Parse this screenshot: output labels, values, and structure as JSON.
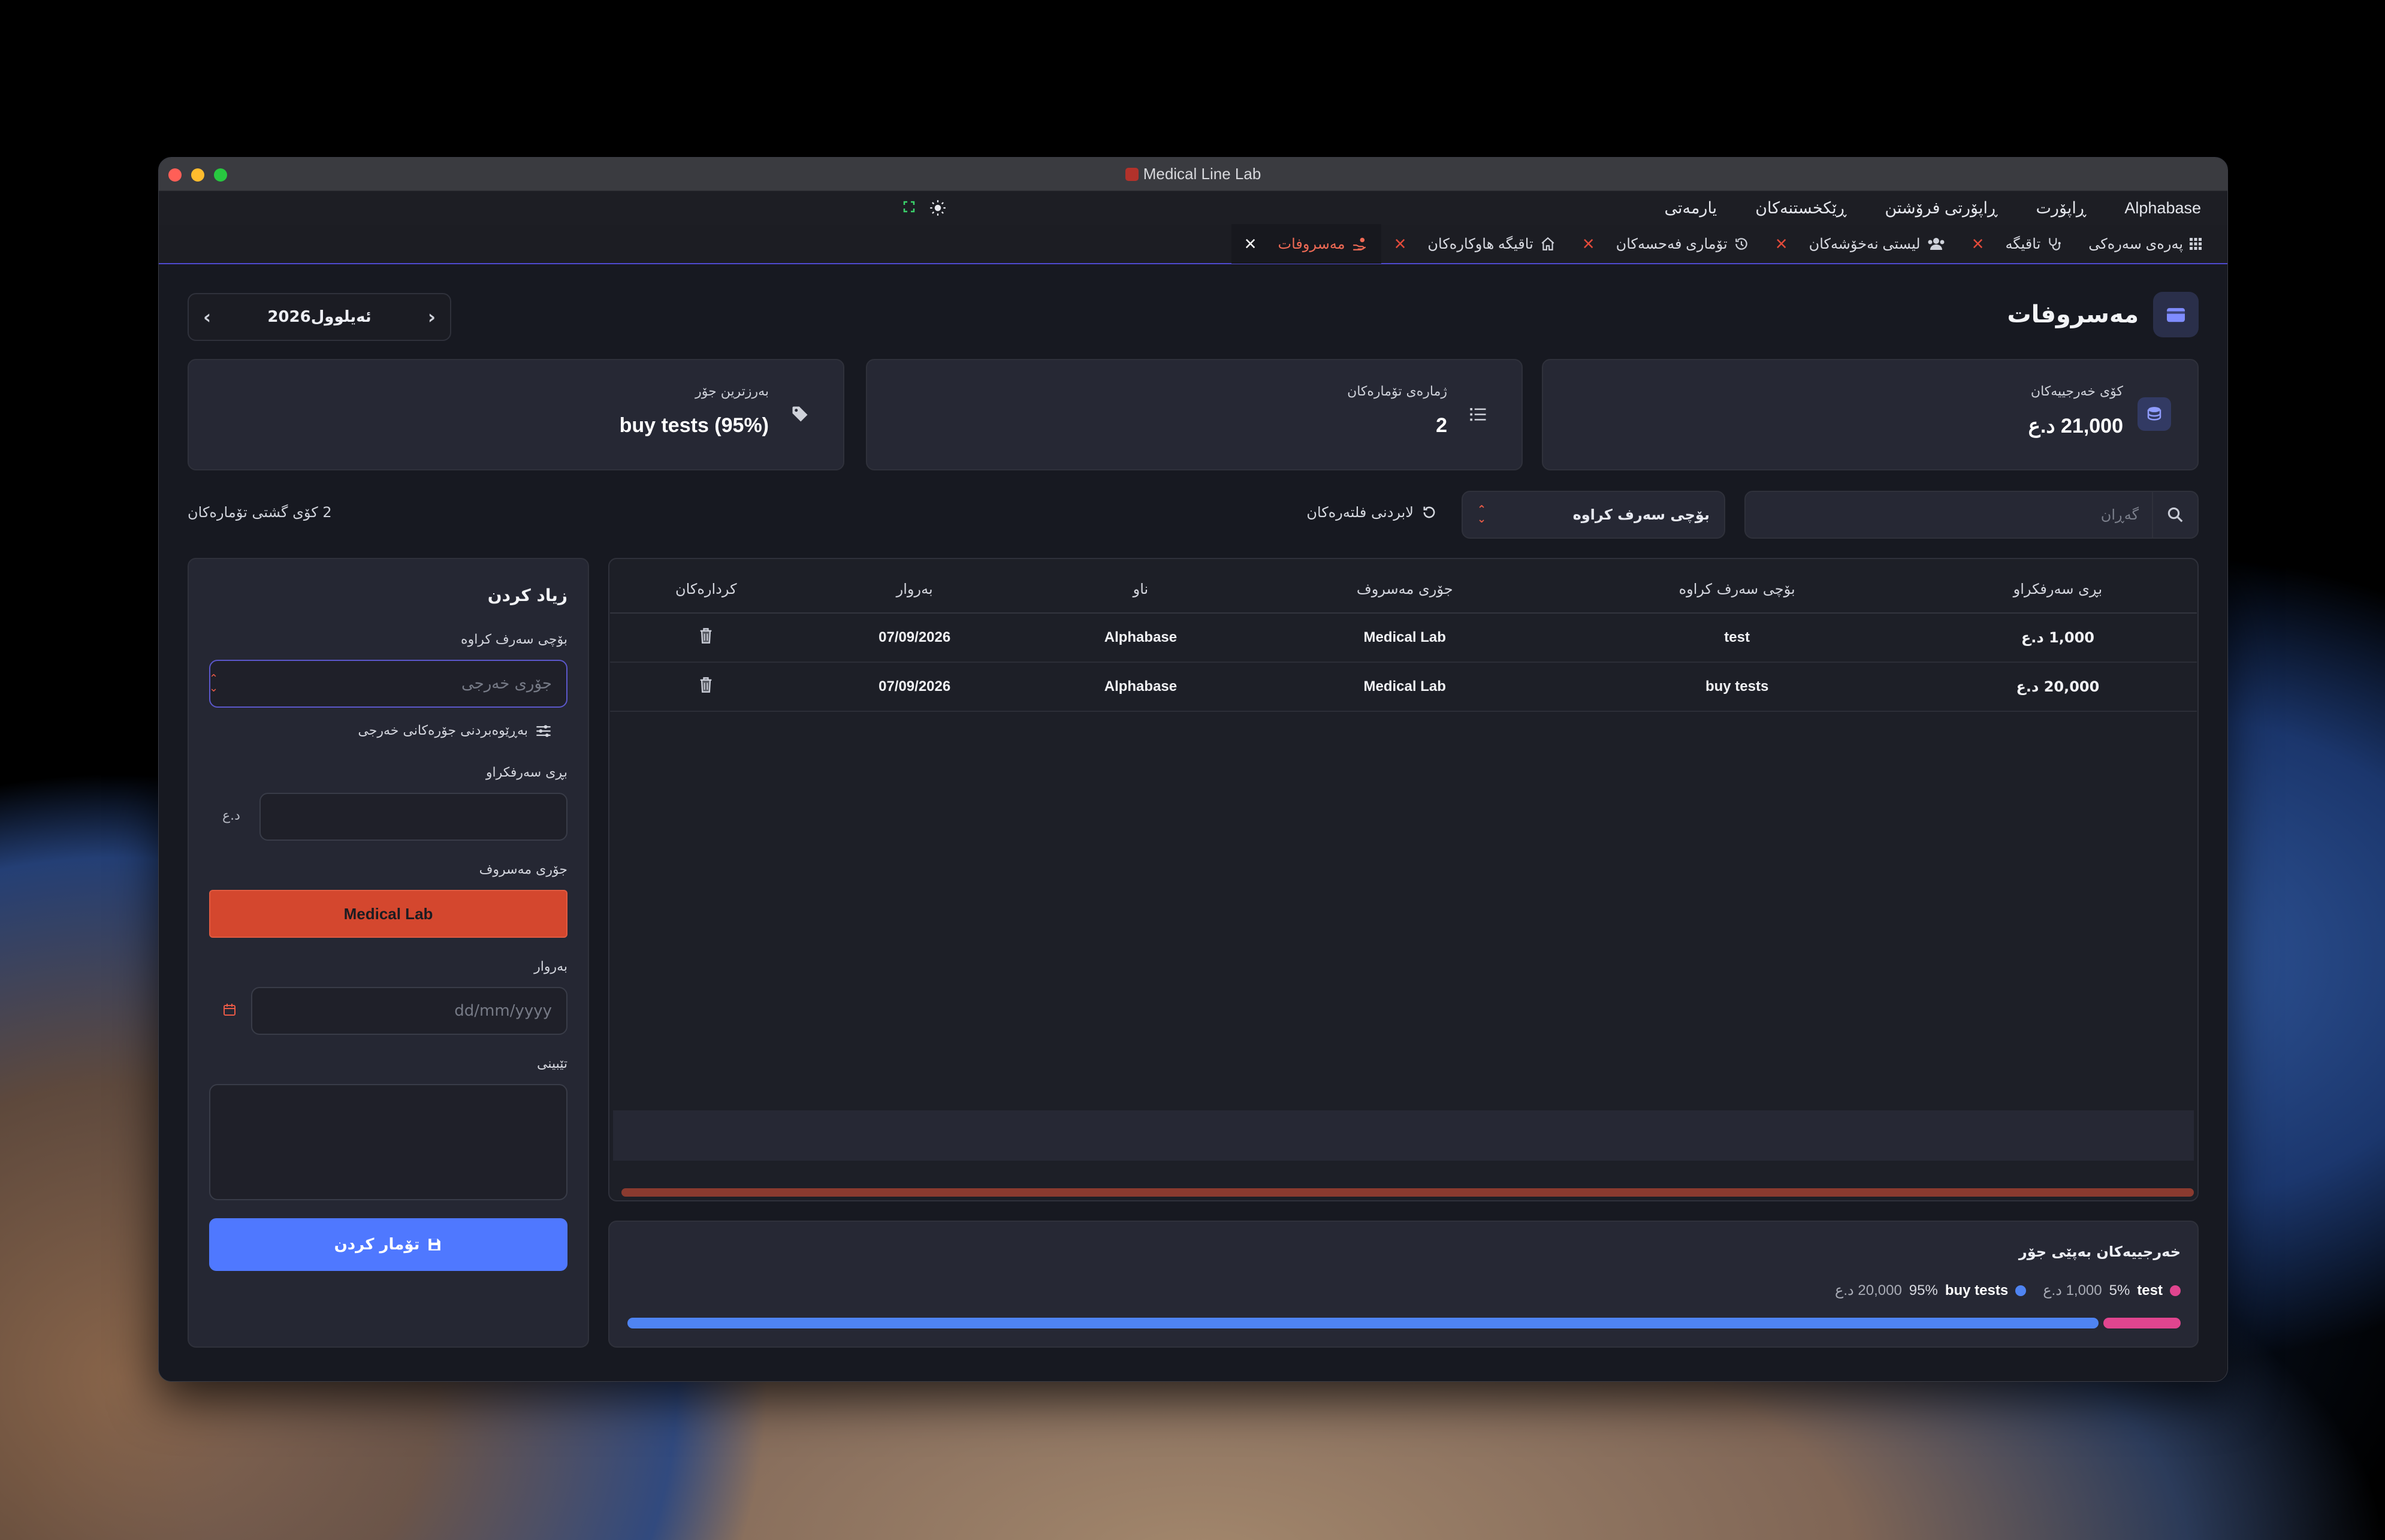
{
  "window": {
    "title": "Medical Line Lab"
  },
  "menu": [
    "Alphabase",
    "ڕاپۆرت",
    "ڕاپۆرتی فرۆشتن",
    "ڕێکخستنەکان",
    "یارمەتی"
  ],
  "tabs": [
    {
      "label": "پەرەی سەرەکی",
      "icon": "grid-icon",
      "closable": false
    },
    {
      "label": "تاقیگە",
      "icon": "stethoscope-icon",
      "closable": true
    },
    {
      "label": "لیستی نەخۆشەکان",
      "icon": "users-icon",
      "closable": true
    },
    {
      "label": "تۆماری فەحسەکان",
      "icon": "history-icon",
      "closable": true
    },
    {
      "label": "تاقیگە هاوکارەکان",
      "icon": "home-icon",
      "closable": true
    },
    {
      "label": "مەسروفات",
      "icon": "hand-coins-icon",
      "closable": true,
      "active": true
    }
  ],
  "page": {
    "title": "مەسروفات",
    "month": "ئەیلوول2026"
  },
  "stats": {
    "total_label": "کۆی خەرجییەکان",
    "total_value": "21,000 د.ع",
    "count_label": "ژمارەی تۆمارەکان",
    "count_value": "2",
    "top_label": "بەرزترین جۆر",
    "top_value": "buy tests (95%)"
  },
  "filters": {
    "search_placeholder": "گەڕان",
    "type_select": "بۆچی سەرف کراوە",
    "reset_label": "لابردنی فلتەرەکان",
    "total_records": "2 کۆی گشتی تۆمارەکان"
  },
  "table": {
    "headers": [
      "بڕی سەرفکراو",
      "بۆچی سەرف کراوە",
      "جۆری مەسروف",
      "ناو",
      "بەروار",
      "کردارەکان"
    ],
    "rows": [
      [
        "1,000 د.ع",
        "test",
        "Medical Lab",
        "Alphabase",
        "07/09/2026"
      ],
      [
        "20,000 د.ع",
        "buy tests",
        "Medical Lab",
        "Alphabase",
        "07/09/2026"
      ]
    ]
  },
  "chart": {
    "title": "خەرجییەکان بەپێی جۆر",
    "colors": {
      "test": "#e0458f",
      "buy_tests": "#4f84f2"
    },
    "items": [
      {
        "name": "test",
        "pct": "5%",
        "amount": "1,000 د.ع",
        "share": 0.05
      },
      {
        "name": "buy tests",
        "pct": "95%",
        "amount": "20,000 د.ع",
        "share": 0.95
      }
    ]
  },
  "form": {
    "title": "زیاد کردن",
    "purpose_label": "بۆچی سەرف کراوە",
    "purpose_placeholder": "جۆری خەرجی",
    "manage_types": "بەڕێوەبردنی جۆرەکانی خەرجی",
    "amount_label": "بڕی سەرفکراو",
    "currency": "د.ع",
    "category_label": "جۆری مەسروف",
    "category_value": "Medical Lab",
    "date_label": "بەروار",
    "date_placeholder": "dd/mm/yyyy",
    "note_label": "تێبینی",
    "save_label": "تۆمار کردن"
  }
}
